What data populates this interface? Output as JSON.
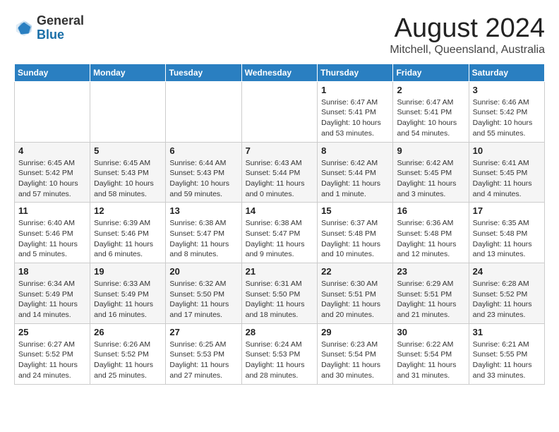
{
  "logo": {
    "general": "General",
    "blue": "Blue"
  },
  "title": "August 2024",
  "subtitle": "Mitchell, Queensland, Australia",
  "days_header": [
    "Sunday",
    "Monday",
    "Tuesday",
    "Wednesday",
    "Thursday",
    "Friday",
    "Saturday"
  ],
  "weeks": [
    [
      {
        "day": "",
        "info": ""
      },
      {
        "day": "",
        "info": ""
      },
      {
        "day": "",
        "info": ""
      },
      {
        "day": "",
        "info": ""
      },
      {
        "day": "1",
        "info": "Sunrise: 6:47 AM\nSunset: 5:41 PM\nDaylight: 10 hours\nand 53 minutes."
      },
      {
        "day": "2",
        "info": "Sunrise: 6:47 AM\nSunset: 5:41 PM\nDaylight: 10 hours\nand 54 minutes."
      },
      {
        "day": "3",
        "info": "Sunrise: 6:46 AM\nSunset: 5:42 PM\nDaylight: 10 hours\nand 55 minutes."
      }
    ],
    [
      {
        "day": "4",
        "info": "Sunrise: 6:45 AM\nSunset: 5:42 PM\nDaylight: 10 hours\nand 57 minutes."
      },
      {
        "day": "5",
        "info": "Sunrise: 6:45 AM\nSunset: 5:43 PM\nDaylight: 10 hours\nand 58 minutes."
      },
      {
        "day": "6",
        "info": "Sunrise: 6:44 AM\nSunset: 5:43 PM\nDaylight: 10 hours\nand 59 minutes."
      },
      {
        "day": "7",
        "info": "Sunrise: 6:43 AM\nSunset: 5:44 PM\nDaylight: 11 hours\nand 0 minutes."
      },
      {
        "day": "8",
        "info": "Sunrise: 6:42 AM\nSunset: 5:44 PM\nDaylight: 11 hours\nand 1 minute."
      },
      {
        "day": "9",
        "info": "Sunrise: 6:42 AM\nSunset: 5:45 PM\nDaylight: 11 hours\nand 3 minutes."
      },
      {
        "day": "10",
        "info": "Sunrise: 6:41 AM\nSunset: 5:45 PM\nDaylight: 11 hours\nand 4 minutes."
      }
    ],
    [
      {
        "day": "11",
        "info": "Sunrise: 6:40 AM\nSunset: 5:46 PM\nDaylight: 11 hours\nand 5 minutes."
      },
      {
        "day": "12",
        "info": "Sunrise: 6:39 AM\nSunset: 5:46 PM\nDaylight: 11 hours\nand 6 minutes."
      },
      {
        "day": "13",
        "info": "Sunrise: 6:38 AM\nSunset: 5:47 PM\nDaylight: 11 hours\nand 8 minutes."
      },
      {
        "day": "14",
        "info": "Sunrise: 6:38 AM\nSunset: 5:47 PM\nDaylight: 11 hours\nand 9 minutes."
      },
      {
        "day": "15",
        "info": "Sunrise: 6:37 AM\nSunset: 5:48 PM\nDaylight: 11 hours\nand 10 minutes."
      },
      {
        "day": "16",
        "info": "Sunrise: 6:36 AM\nSunset: 5:48 PM\nDaylight: 11 hours\nand 12 minutes."
      },
      {
        "day": "17",
        "info": "Sunrise: 6:35 AM\nSunset: 5:48 PM\nDaylight: 11 hours\nand 13 minutes."
      }
    ],
    [
      {
        "day": "18",
        "info": "Sunrise: 6:34 AM\nSunset: 5:49 PM\nDaylight: 11 hours\nand 14 minutes."
      },
      {
        "day": "19",
        "info": "Sunrise: 6:33 AM\nSunset: 5:49 PM\nDaylight: 11 hours\nand 16 minutes."
      },
      {
        "day": "20",
        "info": "Sunrise: 6:32 AM\nSunset: 5:50 PM\nDaylight: 11 hours\nand 17 minutes."
      },
      {
        "day": "21",
        "info": "Sunrise: 6:31 AM\nSunset: 5:50 PM\nDaylight: 11 hours\nand 18 minutes."
      },
      {
        "day": "22",
        "info": "Sunrise: 6:30 AM\nSunset: 5:51 PM\nDaylight: 11 hours\nand 20 minutes."
      },
      {
        "day": "23",
        "info": "Sunrise: 6:29 AM\nSunset: 5:51 PM\nDaylight: 11 hours\nand 21 minutes."
      },
      {
        "day": "24",
        "info": "Sunrise: 6:28 AM\nSunset: 5:52 PM\nDaylight: 11 hours\nand 23 minutes."
      }
    ],
    [
      {
        "day": "25",
        "info": "Sunrise: 6:27 AM\nSunset: 5:52 PM\nDaylight: 11 hours\nand 24 minutes."
      },
      {
        "day": "26",
        "info": "Sunrise: 6:26 AM\nSunset: 5:52 PM\nDaylight: 11 hours\nand 25 minutes."
      },
      {
        "day": "27",
        "info": "Sunrise: 6:25 AM\nSunset: 5:53 PM\nDaylight: 11 hours\nand 27 minutes."
      },
      {
        "day": "28",
        "info": "Sunrise: 6:24 AM\nSunset: 5:53 PM\nDaylight: 11 hours\nand 28 minutes."
      },
      {
        "day": "29",
        "info": "Sunrise: 6:23 AM\nSunset: 5:54 PM\nDaylight: 11 hours\nand 30 minutes."
      },
      {
        "day": "30",
        "info": "Sunrise: 6:22 AM\nSunset: 5:54 PM\nDaylight: 11 hours\nand 31 minutes."
      },
      {
        "day": "31",
        "info": "Sunrise: 6:21 AM\nSunset: 5:55 PM\nDaylight: 11 hours\nand 33 minutes."
      }
    ]
  ]
}
